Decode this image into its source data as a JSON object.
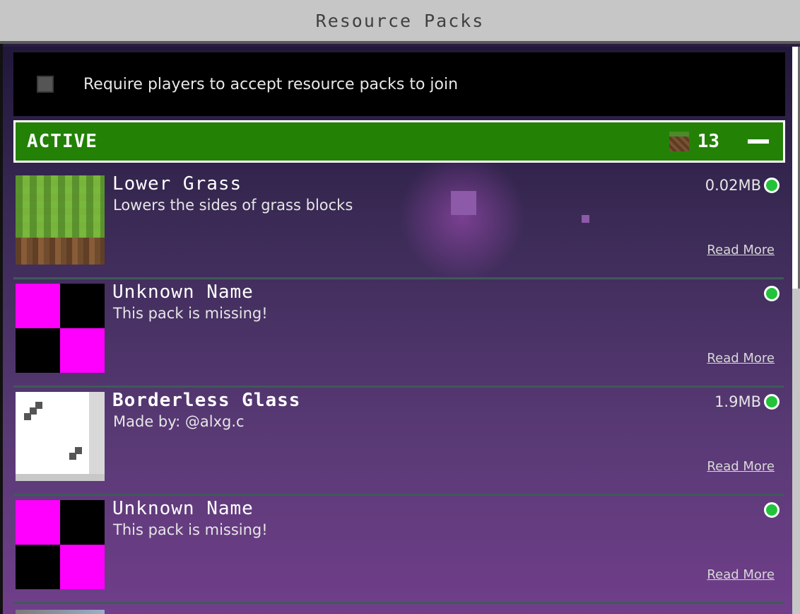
{
  "window": {
    "title": "Resource Packs"
  },
  "require_option": {
    "label": "Require players to accept resource packs to join",
    "checked": false
  },
  "active_section": {
    "label": "ACTIVE",
    "count": "13",
    "count_icon": "grass-block-icon",
    "collapse_icon": "minus-icon"
  },
  "packs": [
    {
      "name": "Lower Grass",
      "description": "Lowers the sides of grass blocks",
      "size": "0.02MB",
      "read_more": "Read More",
      "thumbnail": "grass"
    },
    {
      "name": "Unknown Name",
      "description": "This pack is missing!",
      "size": "",
      "read_more": "Read More",
      "thumbnail": "missing"
    },
    {
      "name": "Borderless Glass",
      "description": "Made by: @alxg.c",
      "size": "1.9MB",
      "read_more": "Read More",
      "thumbnail": "glass"
    },
    {
      "name": "Unknown Name",
      "description": "This pack is missing!",
      "size": "",
      "read_more": "Read More",
      "thumbnail": "missing"
    }
  ],
  "colors": {
    "active_green": "#238106",
    "status_green": "#22c33a",
    "missing_magenta": "#ff00ff"
  }
}
